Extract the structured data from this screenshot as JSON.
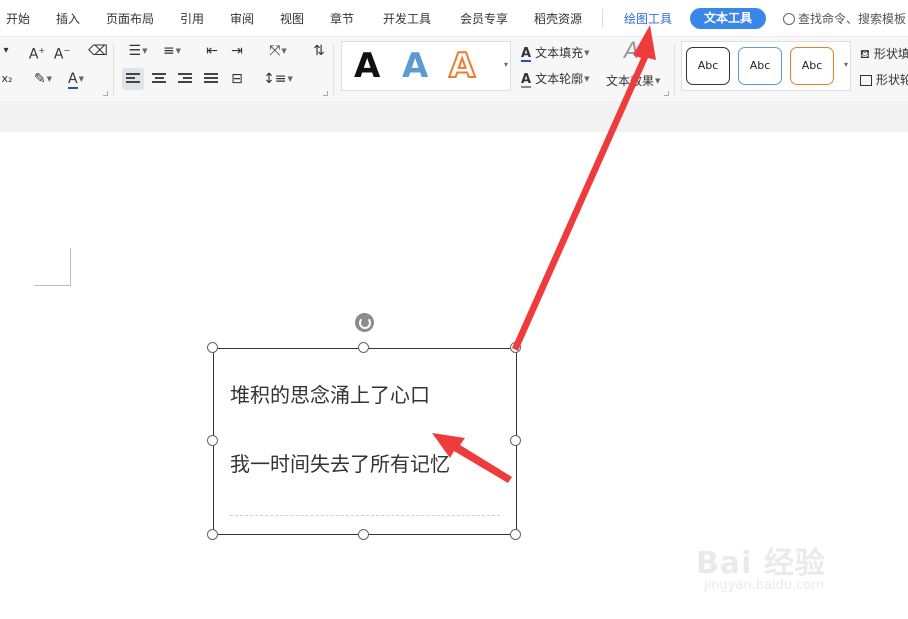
{
  "menubar": {
    "items": [
      {
        "label": "开始"
      },
      {
        "label": "插入"
      },
      {
        "label": "页面布局"
      },
      {
        "label": "引用"
      },
      {
        "label": "审阅"
      },
      {
        "label": "视图"
      },
      {
        "label": "章节"
      },
      {
        "label": "开发工具"
      },
      {
        "label": "会员专享"
      },
      {
        "label": "稻壳资源"
      },
      {
        "label": "绘图工具"
      }
    ],
    "active_tab": "文本工具",
    "search_text": "查找命令、搜索模板"
  },
  "ribbon": {
    "style_gallery": {
      "letters": [
        "A",
        "A",
        "A"
      ]
    },
    "text_fill_label": "文本填充",
    "text_outline_label": "文本轮廓",
    "text_effect_label": "文本效果",
    "shape_gallery": {
      "items": [
        "Abc",
        "Abc",
        "Abc"
      ]
    },
    "shape_fill_label": "形状填",
    "shape_outline_label": "形状轮"
  },
  "textbox": {
    "line1": "堆积的思念涌上了心口",
    "line2": "我一时间失去了所有记忆"
  },
  "watermark": {
    "brand": "Bai 经验",
    "url": "jingyan.baidu.com"
  },
  "colors": {
    "accent_blue": "#3b87e8",
    "arrow_red": "#ef3b3b",
    "style_blue": "#5b9bd5",
    "style_orange": "#ed7d31"
  }
}
